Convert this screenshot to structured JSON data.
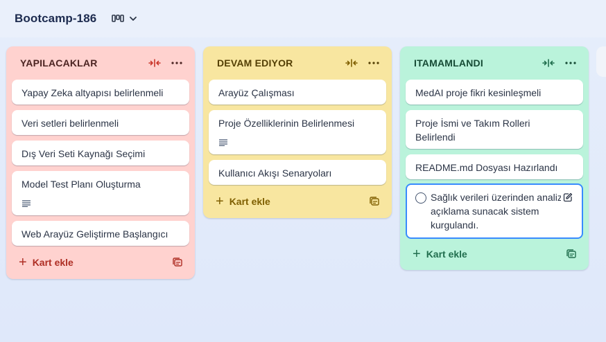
{
  "board": {
    "title": "Bootcamp-186",
    "view_icon": "board-columns-icon",
    "view_chevron": "chevron-down-icon"
  },
  "lists": [
    {
      "title": "YAPILACAKLAR",
      "color": "#ffd2cf",
      "cards": [
        {
          "text": "Yapay Zeka altyapısı belirlenmeli",
          "has_description": false
        },
        {
          "text": "Veri setleri belirlenmeli",
          "has_description": false
        },
        {
          "text": "Dış Veri Seti Kaynağı Seçimi",
          "has_description": false
        },
        {
          "text": "Model Test Planı Oluşturma",
          "has_description": true
        },
        {
          "text": "Web Arayüz Geliştirme Başlangıcı",
          "has_description": false
        }
      ],
      "add_label": "Kart ekle"
    },
    {
      "title": "DEVAM EDIYOR",
      "color": "#f8e6a0",
      "cards": [
        {
          "text": "Arayüz Çalışması",
          "has_description": false
        },
        {
          "text": "Proje Özelliklerinin Belirlenmesi",
          "has_description": true
        },
        {
          "text": "Kullanıcı Akışı Senaryoları",
          "has_description": false
        }
      ],
      "add_label": "Kart ekle"
    },
    {
      "title": "ITAMAMLANDI",
      "color": "#baf3db",
      "cards": [
        {
          "text": "MedAI proje fikri kesinleşmeli",
          "has_description": false
        },
        {
          "text": "Proje İsmi ve Takım Rolleri Belirlendi",
          "has_description": false
        },
        {
          "text": "README.md Dosyası Hazırlandı",
          "has_description": false
        },
        {
          "text": "Sağlık verileri üzerinden analiz ve açıklama sunacak sistem kurgulandı.",
          "has_description": false,
          "editing": true
        }
      ],
      "add_label": "Kart ekle"
    }
  ],
  "icons": {
    "collapse": "collapse-list-icon",
    "more": "more-options-icon",
    "description": "description-icon",
    "template": "card-template-icon",
    "edit": "edit-pencil-icon",
    "complete": "complete-circle-icon"
  }
}
